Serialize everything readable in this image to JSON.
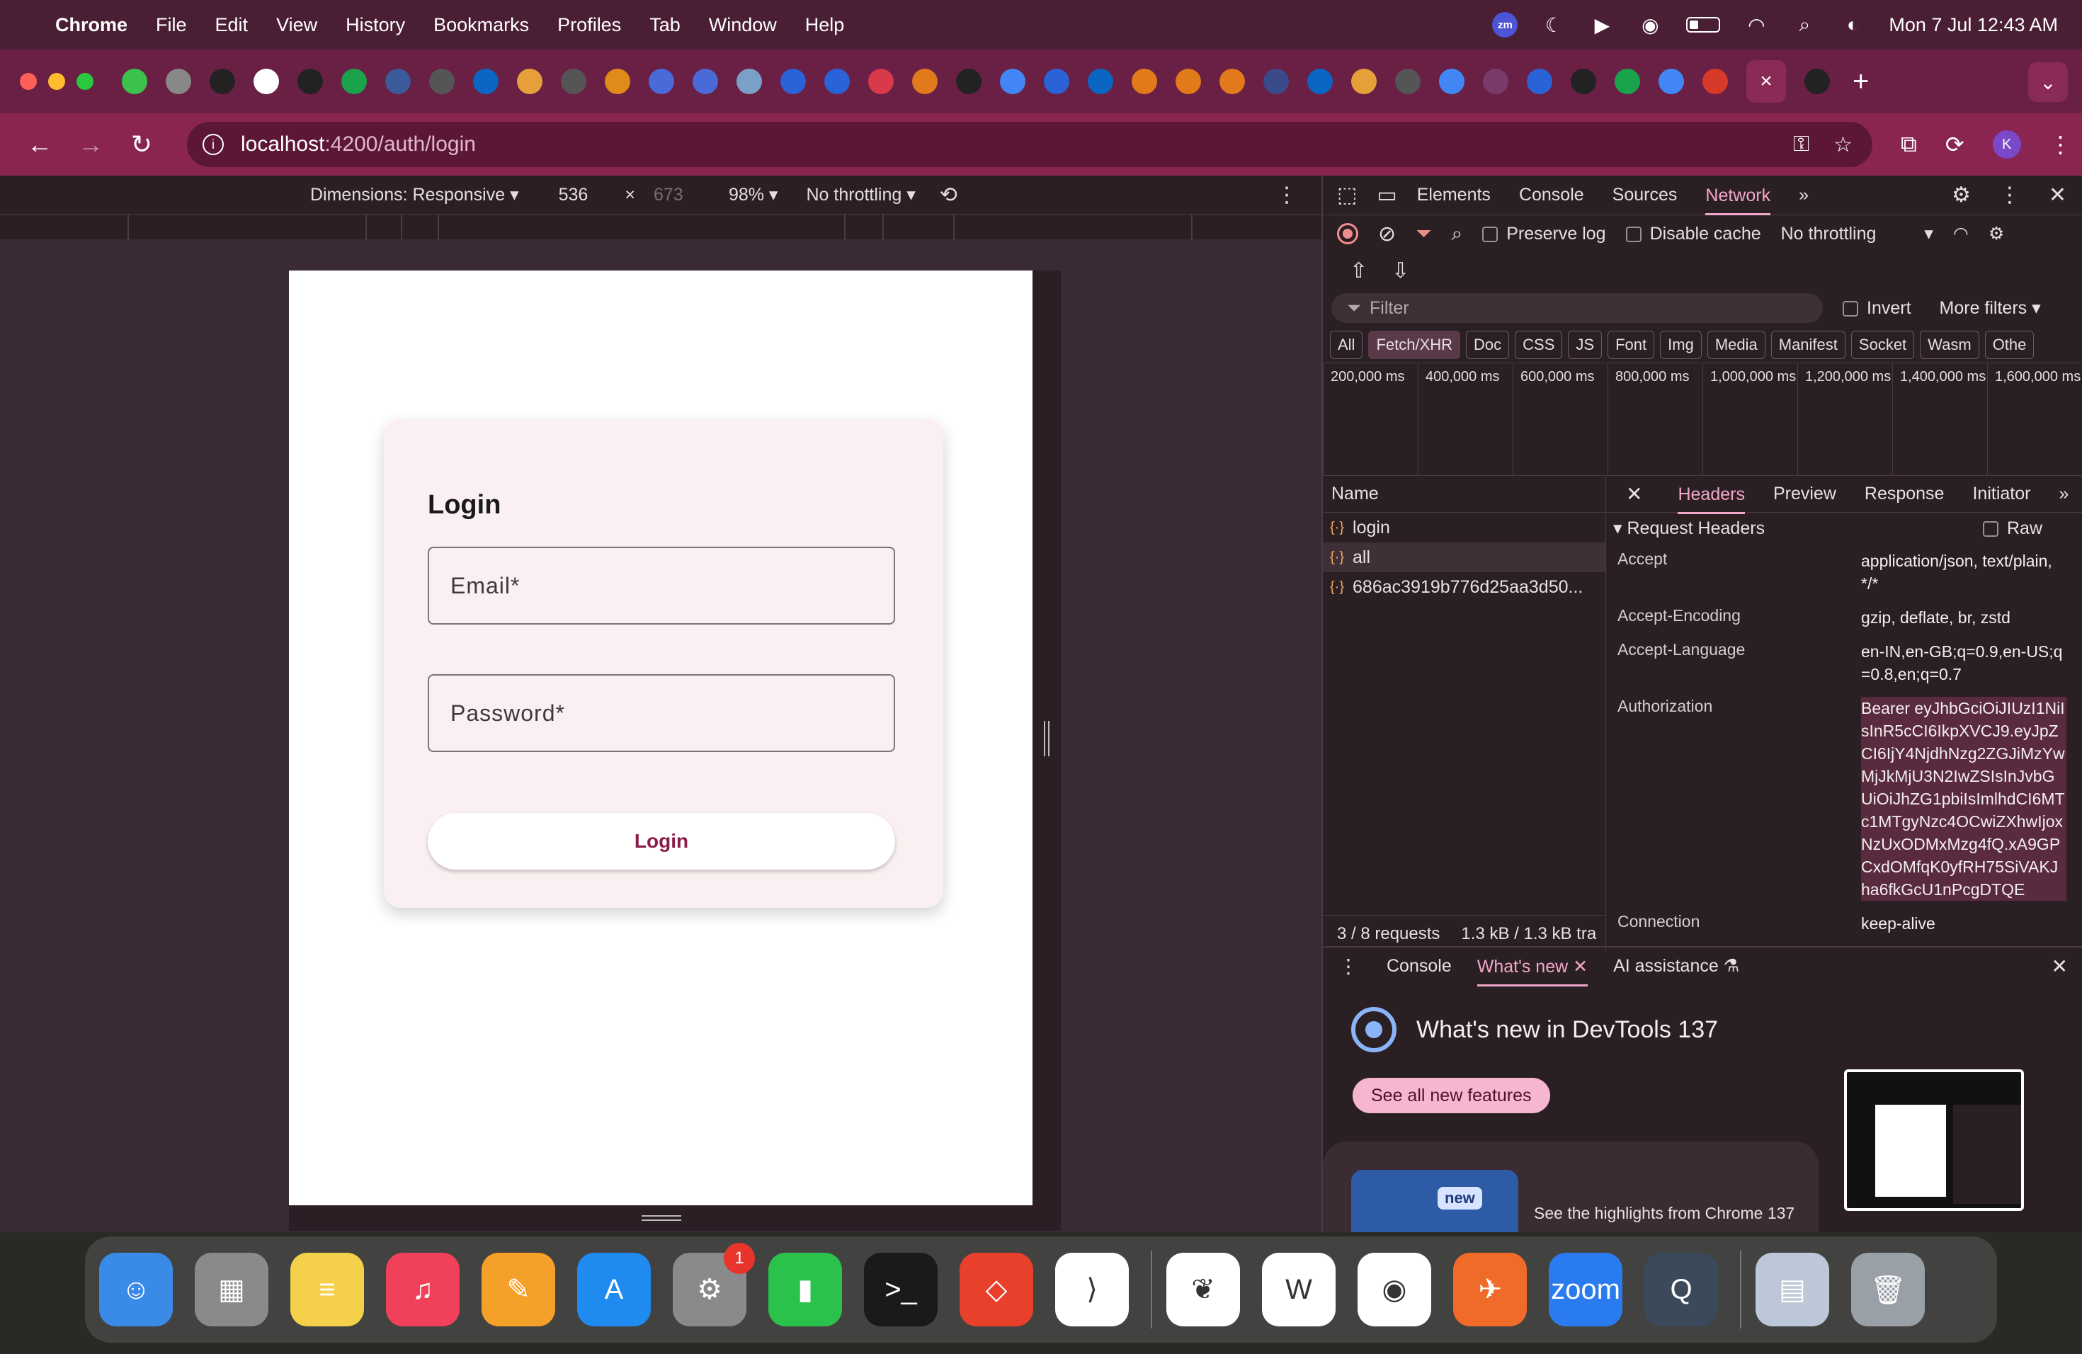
{
  "menubar": {
    "app": "Chrome",
    "items": [
      "File",
      "Edit",
      "View",
      "History",
      "Bookmarks",
      "Profiles",
      "Tab",
      "Window",
      "Help"
    ],
    "zoom_badge": "zm",
    "datetime": "Mon 7 Jul  12:43 AM"
  },
  "tabs": {
    "favicon_colors": [
      "#3ac24a",
      "#888888",
      "#222222",
      "#ffffff",
      "#222222",
      "#1aa34a",
      "#3a5a9a",
      "#555555",
      "#0a66c2",
      "#e6a03a",
      "#555555",
      "#e08a1a",
      "#4a6ad8",
      "#4a6ad8",
      "#7aa0c8",
      "#2a62d8",
      "#2a62d8",
      "#d83a4a",
      "#e07a1a",
      "#222222",
      "#4285f4",
      "#2a62d8",
      "#0a66c2",
      "#e07a1a",
      "#e07a1a",
      "#e07a1a",
      "#3a4a8a",
      "#0a66c2",
      "#e6a03a",
      "#555555",
      "#4285f4",
      "#7a3a6a",
      "#2a62d8",
      "#222222",
      "#1aa34a",
      "#4285f4",
      "#d83a2a",
      "#222222"
    ],
    "active_label": "×",
    "new_tab": "+"
  },
  "toolbar": {
    "url_host": "localhost",
    "url_path": ":4200/auth/login",
    "profile_initial": "K"
  },
  "device_toolbar": {
    "dimensions_label": "Dimensions: Responsive ▾",
    "width": "536",
    "times": "×",
    "height": "673",
    "zoom": "98% ▾",
    "throttling": "No throttling ▾"
  },
  "login": {
    "title": "Login",
    "email_placeholder": "Email*",
    "password_placeholder": "Password*",
    "button": "Login"
  },
  "devtools": {
    "tabs": [
      "Elements",
      "Console",
      "Sources",
      "Network"
    ],
    "active_tab": "Network",
    "preserve_log": "Preserve log",
    "disable_cache": "Disable cache",
    "throttling": "No throttling",
    "filter_placeholder": "Filter",
    "invert": "Invert",
    "more_filters": "More filters ▾",
    "type_filters": [
      "All",
      "Fetch/XHR",
      "Doc",
      "CSS",
      "JS",
      "Font",
      "Img",
      "Media",
      "Manifest",
      "Socket",
      "Wasm",
      "Othe"
    ],
    "active_type": "Fetch/XHR",
    "timeline_ticks": [
      "200,000 ms",
      "400,000 ms",
      "600,000 ms",
      "800,000 ms",
      "1,000,000 ms",
      "1,200,000 ms",
      "1,400,000 ms",
      "1,600,000 ms"
    ],
    "name_header": "Name",
    "requests": [
      {
        "name": "login",
        "selected": false
      },
      {
        "name": "all",
        "selected": true
      },
      {
        "name": "686ac3919b776d25aa3d50...",
        "selected": false
      }
    ],
    "summary_requests": "3 / 8 requests",
    "summary_size": "1.3 kB / 1.3 kB tra",
    "detail_tabs": [
      "Headers",
      "Preview",
      "Response",
      "Initiator"
    ],
    "active_detail_tab": "Headers",
    "section": "▾ Request Headers",
    "raw": "Raw",
    "headers": [
      {
        "name": "Accept",
        "value": "application/json, text/plain, */*"
      },
      {
        "name": "Accept-Encoding",
        "value": "gzip, deflate, br, zstd"
      },
      {
        "name": "Accept-Language",
        "value": "en-IN,en-GB;q=0.9,en-US;q=0.8,en;q=0.7"
      },
      {
        "name": "Authorization",
        "value": "Bearer eyJhbGciOiJIUzI1NiIsInR5cCI6IkpXVCJ9.eyJpZCI6IjY4NjdhNzg2ZGJiMzYwMjJkMjU3N2IwZSIsInJvbGUiOiJhZG1pbiIsImlhdCI6MTc1MTgyNzc4OCwiZXhwIjoxNzUxODMxMzg4fQ.xA9GPCxdOMfqK0yfRH75SiVAKJha6fkGcU1nPcgDTQE"
      },
      {
        "name": "Connection",
        "value": "keep-alive"
      }
    ],
    "drawer_tabs": [
      "Console",
      "What's new",
      "AI assistance"
    ],
    "active_drawer_tab": "What's new",
    "whats_new_title": "What's new in DevTools 137",
    "see_all": "See all new features",
    "highlight_badge": "new",
    "highlight_text": "See the highlights from Chrome 137"
  },
  "dock": {
    "apps": [
      {
        "name": "Finder",
        "color": "#3a8ae8",
        "glyph": "☺"
      },
      {
        "name": "Launchpad",
        "color": "#8a8a8a",
        "glyph": "▦"
      },
      {
        "name": "Notes",
        "color": "#f5d04a",
        "glyph": "≡"
      },
      {
        "name": "Music",
        "color": "#f0405a",
        "glyph": "♫"
      },
      {
        "name": "Pages",
        "color": "#f5a028",
        "glyph": "✎"
      },
      {
        "name": "App Store",
        "color": "#1f8af0",
        "glyph": "A"
      },
      {
        "name": "System Settings",
        "color": "#8a8a8a",
        "glyph": "⚙",
        "badge": "1"
      },
      {
        "name": "Numbers",
        "color": "#2ac24a",
        "glyph": "▮"
      },
      {
        "name": "Terminal",
        "color": "#1a1a1a",
        "glyph": ">_"
      },
      {
        "name": "AnyDesk",
        "color": "#e8402a",
        "glyph": "◇"
      },
      {
        "name": "VS Code",
        "color": "#ffffff",
        "glyph": "⟩"
      },
      {
        "name": "MongoDB Compass",
        "color": "#ffffff",
        "glyph": "❦"
      },
      {
        "name": "Word",
        "color": "#ffffff",
        "glyph": "W"
      },
      {
        "name": "Chrome",
        "color": "#ffffff",
        "glyph": "◉"
      },
      {
        "name": "Postman",
        "color": "#f06a2a",
        "glyph": "✈"
      },
      {
        "name": "Zoom",
        "color": "#2a7af0",
        "glyph": "zoom"
      },
      {
        "name": "QuickTime",
        "color": "#3a4a5a",
        "glyph": "Q"
      },
      {
        "name": "Downloads",
        "color": "#bcc8d8",
        "glyph": "▤"
      },
      {
        "name": "Trash",
        "color": "#9aa0a8",
        "glyph": "🗑"
      }
    ]
  }
}
